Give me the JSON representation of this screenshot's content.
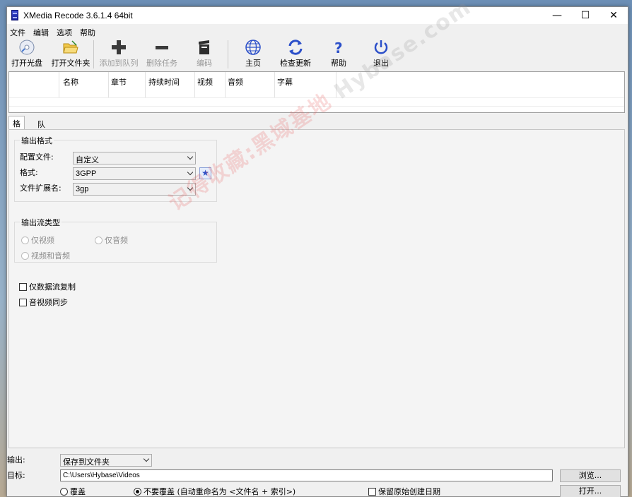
{
  "window": {
    "title": "XMedia Recode 3.6.1.4 64bit",
    "min": "—",
    "max": "☐",
    "close": "✕"
  },
  "menu": [
    "文件",
    "编辑",
    "选项",
    "帮助"
  ],
  "toolbar": [
    {
      "label": "打开光盘",
      "icon": "disc-icon",
      "enabled": true
    },
    {
      "label": "打开文件夹",
      "icon": "folder-open-icon",
      "enabled": true
    },
    {
      "label": "添加到队列",
      "icon": "plus-icon",
      "enabled": false
    },
    {
      "label": "删除任务",
      "icon": "minus-icon",
      "enabled": false
    },
    {
      "label": "编码",
      "icon": "clapper-icon",
      "enabled": false
    },
    {
      "label": "主页",
      "icon": "globe-icon",
      "enabled": true
    },
    {
      "label": "检查更新",
      "icon": "refresh-icon",
      "enabled": true
    },
    {
      "label": "帮助",
      "icon": "question-icon",
      "enabled": true
    },
    {
      "label": "退出",
      "icon": "power-icon",
      "enabled": true
    }
  ],
  "list": {
    "columns": [
      "",
      "名称",
      "章节",
      "持续时间",
      "视频",
      "音频",
      "字幕"
    ]
  },
  "tabs": [
    {
      "label": "格式",
      "active": true
    },
    {
      "label": "队列",
      "active": false
    }
  ],
  "format": {
    "group_title": "输出格式",
    "profile_label": "配置文件:",
    "profile_value": "自定义",
    "format_label": "格式:",
    "format_value": "3GPP",
    "ext_label": "文件扩展名:",
    "ext_value": "3gp"
  },
  "stream": {
    "group_title": "输出流类型",
    "video_only": "仅视频",
    "audio_only": "仅音频",
    "video_audio": "视频和音频"
  },
  "options": {
    "data_copy": "仅数据流复制",
    "av_sync": "音视频同步"
  },
  "watermark": {
    "cn": "记得收藏:黑域基地",
    "en": "Hybase.com"
  },
  "bottom": {
    "output_label": "输出:",
    "output_value": "保存到文件夹",
    "target_label": "目标:",
    "target_value": "C:\\Users\\Hybase\\Videos",
    "browse": "浏览...",
    "open": "打开...",
    "overwrite": "覆盖",
    "no_overwrite": "不要覆盖 (自动重命名为 <文件名 + 索引>)",
    "keep_date": "保留原始创建日期"
  },
  "colors": {
    "accent": "#2b4fc9",
    "power": "#2b4fc9"
  }
}
